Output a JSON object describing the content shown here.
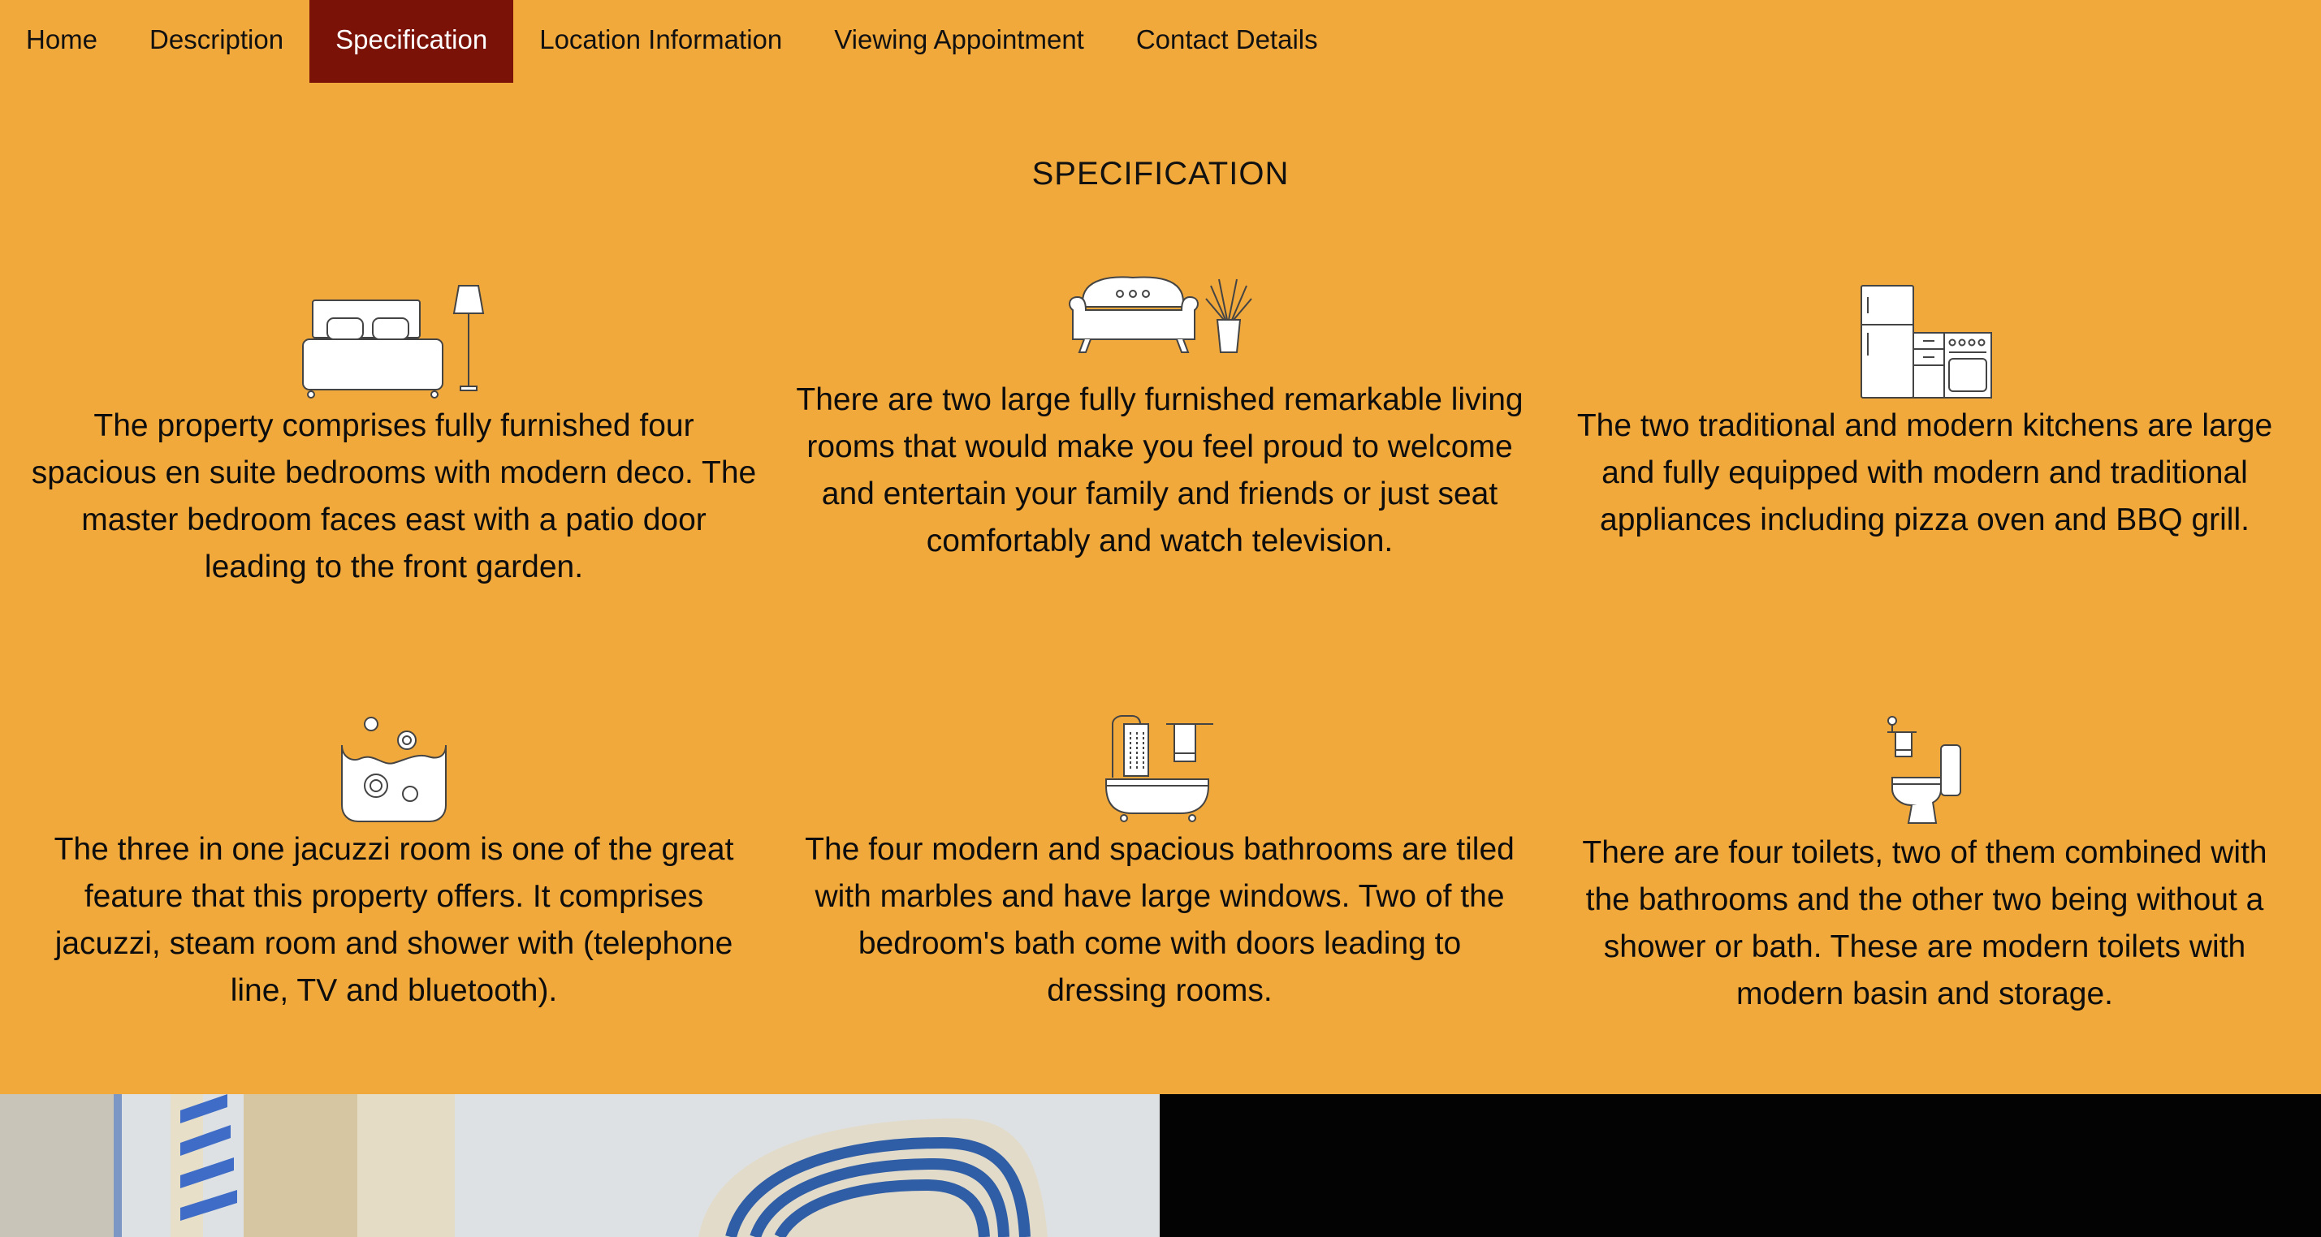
{
  "nav": {
    "items": [
      {
        "label": "Home",
        "active": false
      },
      {
        "label": "Description",
        "active": false
      },
      {
        "label": "Specification",
        "active": true
      },
      {
        "label": "Location Information",
        "active": false
      },
      {
        "label": "Viewing Appointment",
        "active": false
      },
      {
        "label": "Contact Details",
        "active": false
      }
    ]
  },
  "section": {
    "title": "SPECIFICATION"
  },
  "features": [
    {
      "icon": "bed-lamp-icon",
      "text": "The property comprises fully furnished four spacious en suite bedrooms with modern deco. The master bedroom faces east with a patio door leading to the front garden."
    },
    {
      "icon": "sofa-plant-icon",
      "text": "There are two large fully furnished remarkable living rooms that would make you feel proud to welcome and entertain your family and friends or just seat comfortably and watch television."
    },
    {
      "icon": "kitchen-appliances-icon",
      "text": "The two traditional and modern kitchens are large and fully equipped with modern and traditional appliances including pizza oven and BBQ grill."
    },
    {
      "icon": "jacuzzi-icon",
      "text": "The three in one jacuzzi room is one of the great feature that this property offers. It comprises jacuzzi, steam room and shower with (telephone line, TV and bluetooth)."
    },
    {
      "icon": "bathtub-shower-icon",
      "text": "The four modern and spacious bathrooms are tiled with marbles and have large windows. Two of the bedroom's bath come with doors leading to dressing rooms."
    },
    {
      "icon": "toilet-icon",
      "text": "There are four toilets, two of them combined with the bathrooms and the other two being without a shower or bath. These are modern toilets with modern basin and storage."
    }
  ],
  "colors": {
    "background": "#f2a93b",
    "active_tab": "#7a1208",
    "icon_stroke": "#444444"
  }
}
